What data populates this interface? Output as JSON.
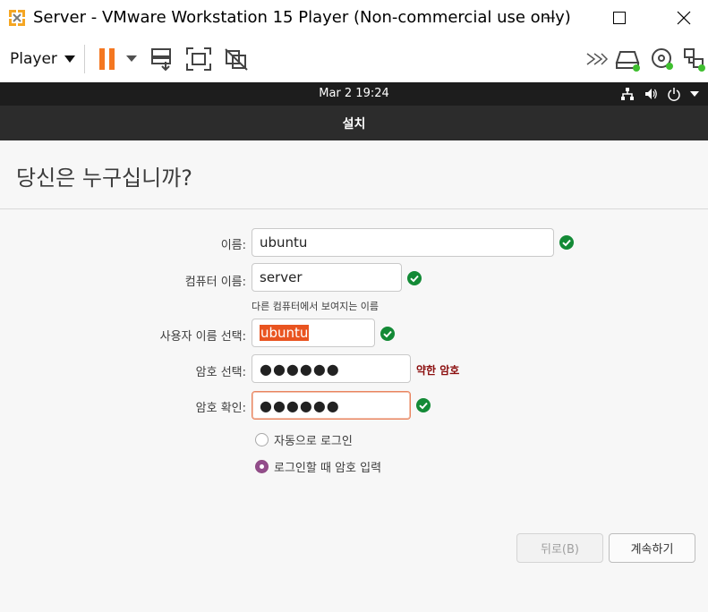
{
  "window": {
    "title": "Server - VMware Workstation 15 Player (Non-commercial use only)",
    "controls": [
      "minimize-icon",
      "maximize-icon",
      "close-icon"
    ]
  },
  "toolbar": {
    "player_label": "Player",
    "icons": [
      "pause-icon",
      "dropdown-caret-icon",
      "send-ctrl-alt-del-icon",
      "full-screen-icon",
      "unity-disabled-icon",
      "chevrons-right-icon",
      "hard-disk-icon",
      "cd-dvd-icon",
      "network-adapter-icon"
    ],
    "accent_color": "#f47721",
    "status_color": "#3fbf2f"
  },
  "ubuntu_panel": {
    "clock": "Mar 2  19:24",
    "system_icons": [
      "network-icon",
      "volume-icon",
      "power-icon",
      "caret-down-icon"
    ]
  },
  "installer": {
    "header_title": "설치",
    "page_heading": "당신은 누구십니까?",
    "fields": {
      "name": {
        "label": "이름:",
        "value": "ubuntu"
      },
      "computer_name": {
        "label": "컴퓨터 이름:",
        "value": "server",
        "hint": "다른 컴퓨터에서 보여지는 이름"
      },
      "username": {
        "label": "사용자 이름 선택:",
        "value": "ubuntu"
      },
      "password": {
        "label": "암호 선택:",
        "value": "●●●●●●",
        "strength": "약한 암호"
      },
      "password_confirm": {
        "label": "암호 확인:",
        "value": "●●●●●●"
      }
    },
    "login_options": {
      "auto_login": {
        "label": "자동으로 로그인",
        "selected": false
      },
      "require_password": {
        "label": "로그인할 때 암호 입력",
        "selected": true
      }
    },
    "buttons": {
      "back": "뒤로(B)",
      "continue": "계속하기"
    },
    "colors": {
      "ok_green": "#138a36",
      "selection_orange": "#e95420",
      "weak_red": "#8b0e0e",
      "radio_purple": "#924d8b"
    }
  }
}
